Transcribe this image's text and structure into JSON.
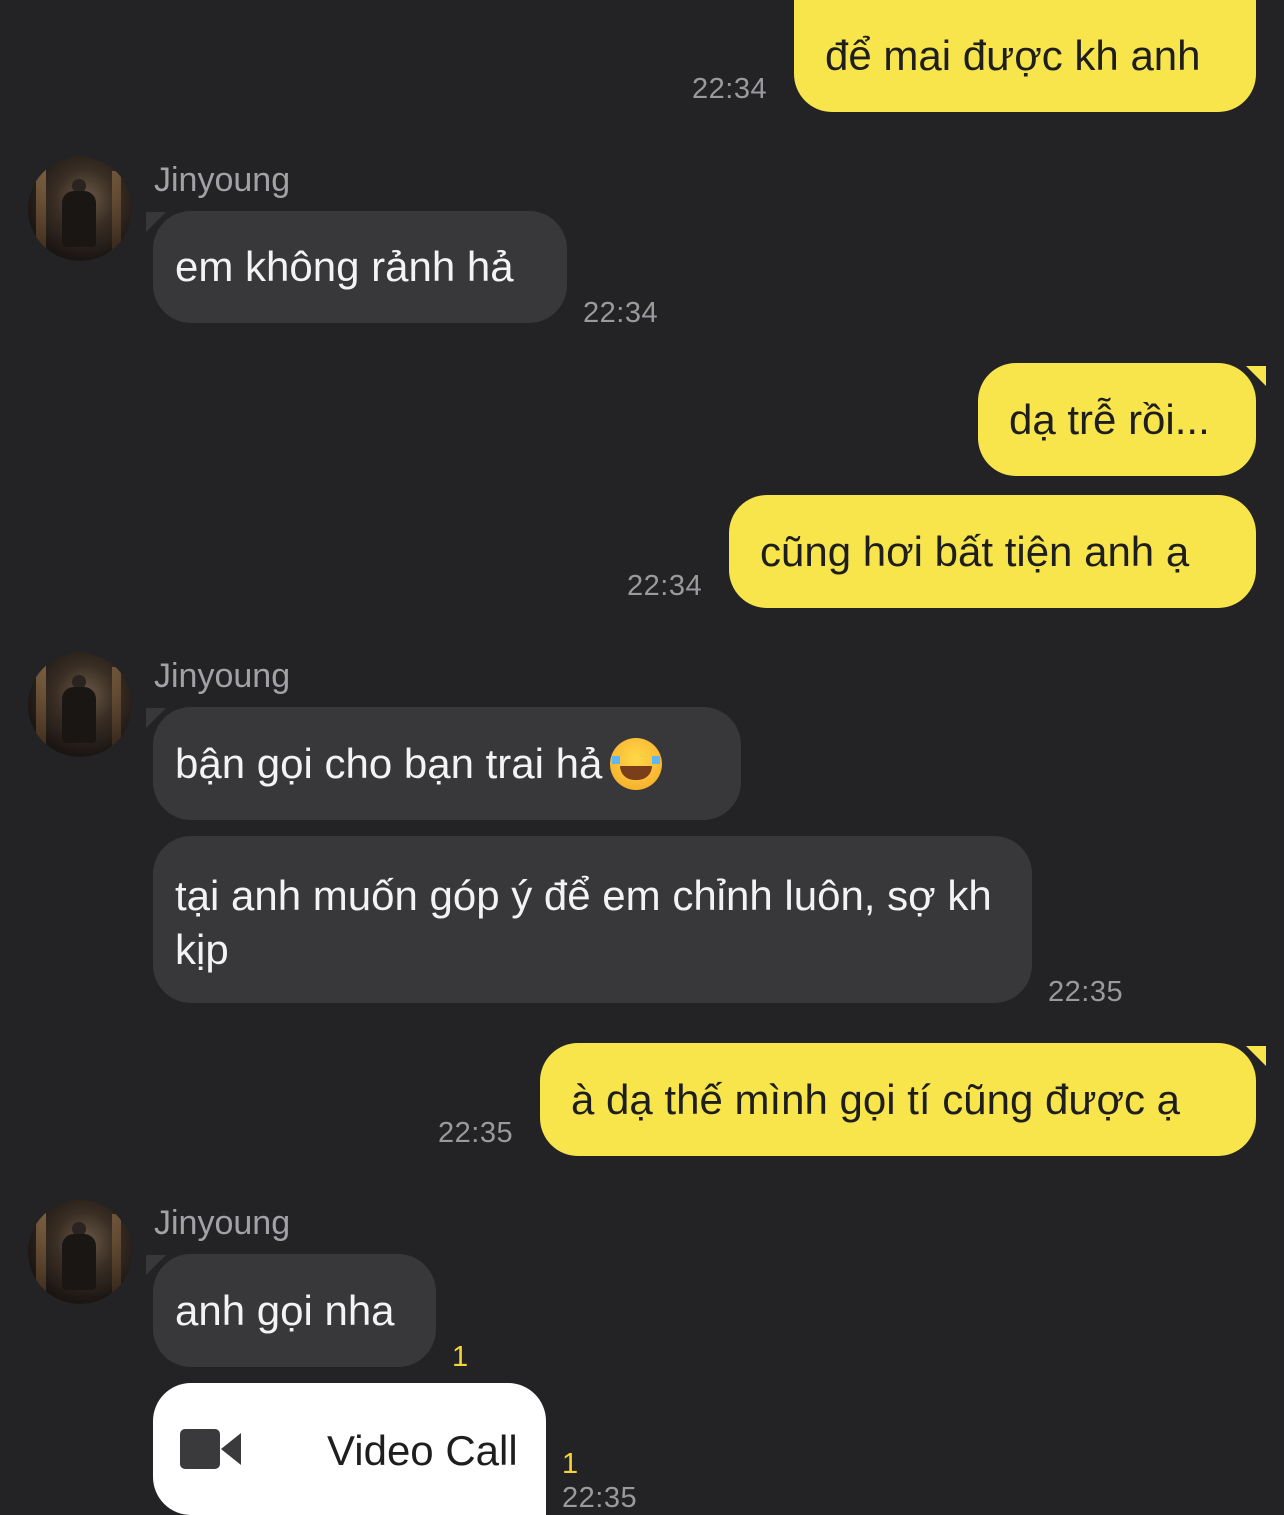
{
  "contact": {
    "name": "Jinyoung"
  },
  "messages": [
    {
      "id": "m1",
      "text": "để mai được kh anh",
      "time": "22:34"
    },
    {
      "id": "m2",
      "text": "em không rảnh hả",
      "time": "22:34"
    },
    {
      "id": "m3",
      "text": "dạ trễ rồi..."
    },
    {
      "id": "m4",
      "text": "cũng hơi bất tiện anh ạ",
      "time": "22:34"
    },
    {
      "id": "m5",
      "text": "bận gọi cho bạn trai hả",
      "emoji": "face-with-tears-of-joy"
    },
    {
      "id": "m6",
      "text": "tại anh muốn góp ý để em chỉnh luôn, sợ kh kịp",
      "time": "22:35"
    },
    {
      "id": "m7",
      "text": "à dạ thế mình gọi tí cũng được ạ",
      "time": "22:35"
    },
    {
      "id": "m8",
      "text": "anh gọi nha",
      "unread": "1"
    },
    {
      "id": "m9",
      "text": "Video Call",
      "icon": "video-camera-icon",
      "unread": "1",
      "time": "22:35"
    }
  ],
  "colors": {
    "background": "#232325",
    "outgoing": "#f8e54c",
    "incoming": "#38383b",
    "call": "#ffffff",
    "unread": "#f3d43a"
  }
}
